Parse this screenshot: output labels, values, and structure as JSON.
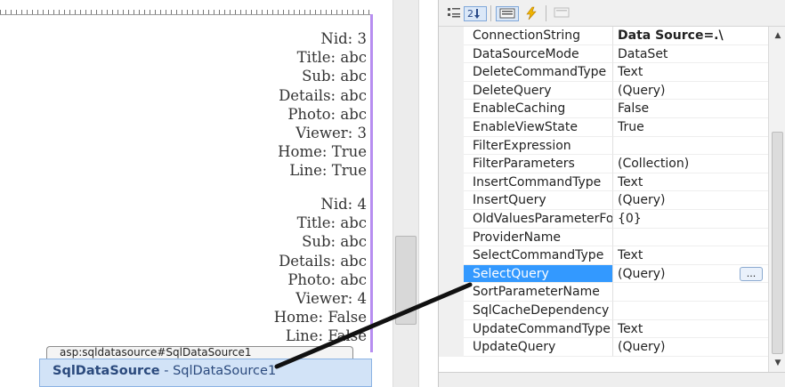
{
  "designer": {
    "expand_glyph": ">",
    "records": [
      [
        "Nid: 3",
        "Title: abc",
        "Sub: abc",
        "Details: abc",
        "Photo: abc",
        "Viewer: 3",
        "Home: True",
        "Line: True"
      ],
      [
        "Nid: 4",
        "Title: abc",
        "Sub: abc",
        "Details: abc",
        "Photo: abc",
        "Viewer: 4",
        "Home: False",
        "Line: False"
      ]
    ],
    "control_tag": "asp:sqldatasource#SqlDataSource1",
    "control_type": "SqlDataSource",
    "control_sep": " - ",
    "control_id": "SqlDataSource1"
  },
  "toolbar": {
    "categorized_icon": "categorized-icon",
    "alphabetical_icon": "alphabetical-icon",
    "properties_icon": "properties-icon",
    "events_icon": "lightning-icon",
    "property_pages_icon": "property-pages-icon"
  },
  "properties": [
    {
      "name": "ConnectionString",
      "value": "Data Source=.\\",
      "bold": true
    },
    {
      "name": "DataSourceMode",
      "value": "DataSet"
    },
    {
      "name": "DeleteCommandType",
      "value": "Text"
    },
    {
      "name": "DeleteQuery",
      "value": "(Query)"
    },
    {
      "name": "EnableCaching",
      "value": "False"
    },
    {
      "name": "EnableViewState",
      "value": "True"
    },
    {
      "name": "FilterExpression",
      "value": ""
    },
    {
      "name": "FilterParameters",
      "value": "(Collection)"
    },
    {
      "name": "InsertCommandType",
      "value": "Text"
    },
    {
      "name": "InsertQuery",
      "value": "(Query)"
    },
    {
      "name": "OldValuesParameterFormatString",
      "value": "{0}"
    },
    {
      "name": "ProviderName",
      "value": ""
    },
    {
      "name": "SelectCommandType",
      "value": "Text"
    },
    {
      "name": "SelectQuery",
      "value": "(Query)",
      "selected": true,
      "ellipsis": "..."
    },
    {
      "name": "SortParameterName",
      "value": ""
    },
    {
      "name": "SqlCacheDependency",
      "value": ""
    },
    {
      "name": "UpdateCommandType",
      "value": "Text"
    },
    {
      "name": "UpdateQuery",
      "value": "(Query)"
    }
  ],
  "colors": {
    "selection": "#3399ff",
    "control_box": "#d2e3f7",
    "design_border": "#b78ef0",
    "annotation_arrow": "#111111"
  }
}
